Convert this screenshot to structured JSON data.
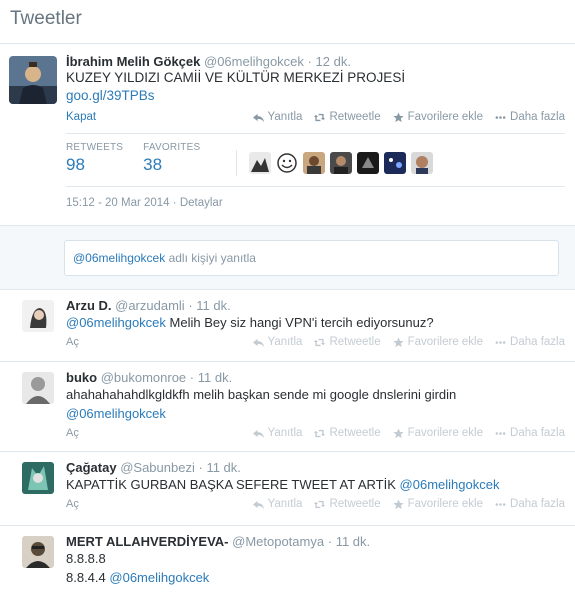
{
  "page": {
    "title": "Tweetler"
  },
  "main_tweet": {
    "name": "İbrahim Melih Gökçek",
    "handle": "@06melihgokcek",
    "time": "12 dk.",
    "text": "KUZEY YILDIZI CAMİİ VE KÜLTÜR MERKEZİ PROJESİ",
    "link": "goo.gl/39TPBs",
    "collapse": "Kapat",
    "actions": {
      "reply": "Yanıtla",
      "retweet": "Retweetle",
      "favorite": "Favorilere ekle",
      "more": "Daha fazla"
    },
    "stats": {
      "retweets_label": "RETWEETS",
      "retweets": "98",
      "favorites_label": "FAVORITES",
      "favorites": "38"
    },
    "timestamp": "15:12 - 20 Mar 2014",
    "details": "Detaylar"
  },
  "reply": {
    "mention": "@06melihgokcek",
    "placeholder": "adlı kişiyi yanıtla"
  },
  "replies": [
    {
      "name": "Arzu D.",
      "handle": "@arzudamli",
      "time": "11 dk.",
      "mention": "@06melihgokcek",
      "text": " Melih Bey siz hangi VPN'i tercih ediyorsunuz?",
      "expand": "Aç"
    },
    {
      "name": "buko",
      "handle": "@bukomonroe",
      "time": "11 dk.",
      "text": "ahahahahahdlkgldkfh melih başkan sende mi google dnslerini girdin",
      "mention": "@06melihgokcek",
      "expand": "Aç"
    },
    {
      "name": "Çağatay",
      "handle": "@Sabunbezi",
      "time": "11 dk.",
      "text": "KAPATTİK GURBAN BAŞKA SEFERE TWEET AT ARTİK ",
      "mention": "@06melihgokcek",
      "expand": "Aç"
    },
    {
      "name": "MERT ALLAHVERDİYEVA-",
      "handle": "@Metopotamya",
      "time": "11 dk.",
      "line1": "8.8.8.8",
      "line2": "8.8.4.4",
      "mention": "@06melihgokcek"
    }
  ],
  "colors": {
    "link": "#2b7bb9",
    "muted": "#8899a6",
    "text": "#292f33",
    "border": "#e1e8ed"
  },
  "icons": {
    "reply": "reply-arrow-icon",
    "retweet": "retweet-icon",
    "favorite": "star-icon",
    "more": "ellipsis-icon"
  }
}
